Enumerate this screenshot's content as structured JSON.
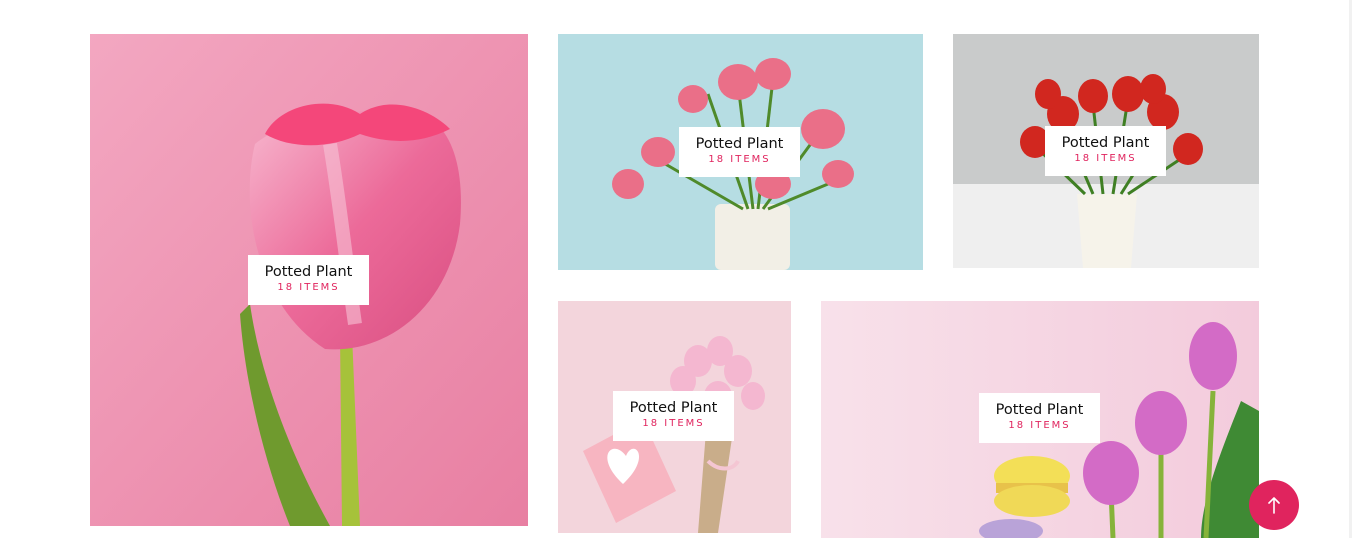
{
  "categories": [
    {
      "title": "Potted Plant",
      "count": "18 ITEMS"
    },
    {
      "title": "Potted Plant",
      "count": "18 ITEMS"
    },
    {
      "title": "Potted Plant",
      "count": "18 ITEMS"
    },
    {
      "title": "Potted Plant",
      "count": "18 ITEMS"
    },
    {
      "title": "Potted Plant",
      "count": "18 ITEMS"
    }
  ],
  "colors": {
    "accent": "#e0245e"
  },
  "scroll_top_icon": "arrow-up-icon"
}
